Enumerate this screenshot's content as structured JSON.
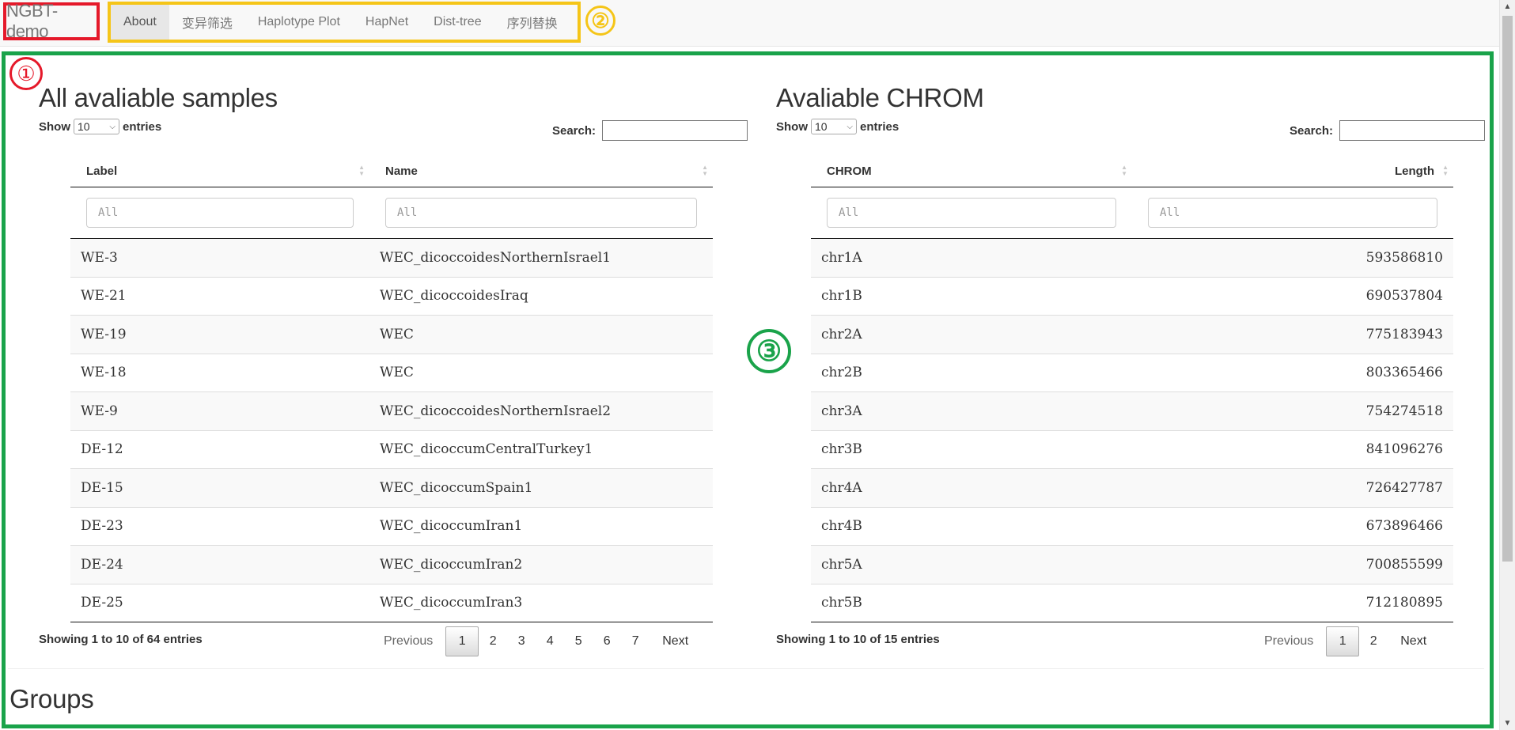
{
  "nav": {
    "brand": "NGBT-demo",
    "tabs": [
      {
        "label": "About",
        "active": true
      },
      {
        "label": "变异筛选"
      },
      {
        "label": "Haplotype Plot"
      },
      {
        "label": "HapNet"
      },
      {
        "label": "Dist-tree"
      },
      {
        "label": "序列替换"
      }
    ]
  },
  "annotations": {
    "one": "①",
    "two": "②",
    "three": "③"
  },
  "samples": {
    "title": "All avaliable samples",
    "show_label": "Show",
    "length_value": "10",
    "entries_label": "entries",
    "search_label": "Search:",
    "columns": [
      "Label",
      "Name"
    ],
    "filter_placeholder": "All",
    "rows": [
      [
        "WE-3",
        "WEC_dicoccoidesNorthernIsrael1"
      ],
      [
        "WE-21",
        "WEC_dicoccoidesIraq"
      ],
      [
        "WE-19",
        "WEC"
      ],
      [
        "WE-18",
        "WEC"
      ],
      [
        "WE-9",
        "WEC_dicoccoidesNorthernIsrael2"
      ],
      [
        "DE-12",
        "WEC_dicoccumCentralTurkey1"
      ],
      [
        "DE-15",
        "WEC_dicoccumSpain1"
      ],
      [
        "DE-23",
        "WEC_dicoccumIran1"
      ],
      [
        "DE-24",
        "WEC_dicoccumIran2"
      ],
      [
        "DE-25",
        "WEC_dicoccumIran3"
      ]
    ],
    "info": "Showing 1 to 10 of 64 entries",
    "pager": {
      "previous": "Previous",
      "pages": [
        "1",
        "2",
        "3",
        "4",
        "5",
        "6",
        "7"
      ],
      "current": "1",
      "next": "Next"
    }
  },
  "chrom": {
    "title": "Avaliable CHROM",
    "show_label": "Show",
    "length_value": "10",
    "entries_label": "entries",
    "search_label": "Search:",
    "columns": [
      "CHROM",
      "Length"
    ],
    "filter_placeholder": "All",
    "rows": [
      [
        "chr1A",
        "593586810"
      ],
      [
        "chr1B",
        "690537804"
      ],
      [
        "chr2A",
        "775183943"
      ],
      [
        "chr2B",
        "803365466"
      ],
      [
        "chr3A",
        "754274518"
      ],
      [
        "chr3B",
        "841096276"
      ],
      [
        "chr4A",
        "726427787"
      ],
      [
        "chr4B",
        "673896466"
      ],
      [
        "chr5A",
        "700855599"
      ],
      [
        "chr5B",
        "712180895"
      ]
    ],
    "info": "Showing 1 to 10 of 15 entries",
    "pager": {
      "previous": "Previous",
      "pages": [
        "1",
        "2"
      ],
      "current": "1",
      "next": "Next"
    }
  },
  "groups": {
    "title": "Groups"
  }
}
